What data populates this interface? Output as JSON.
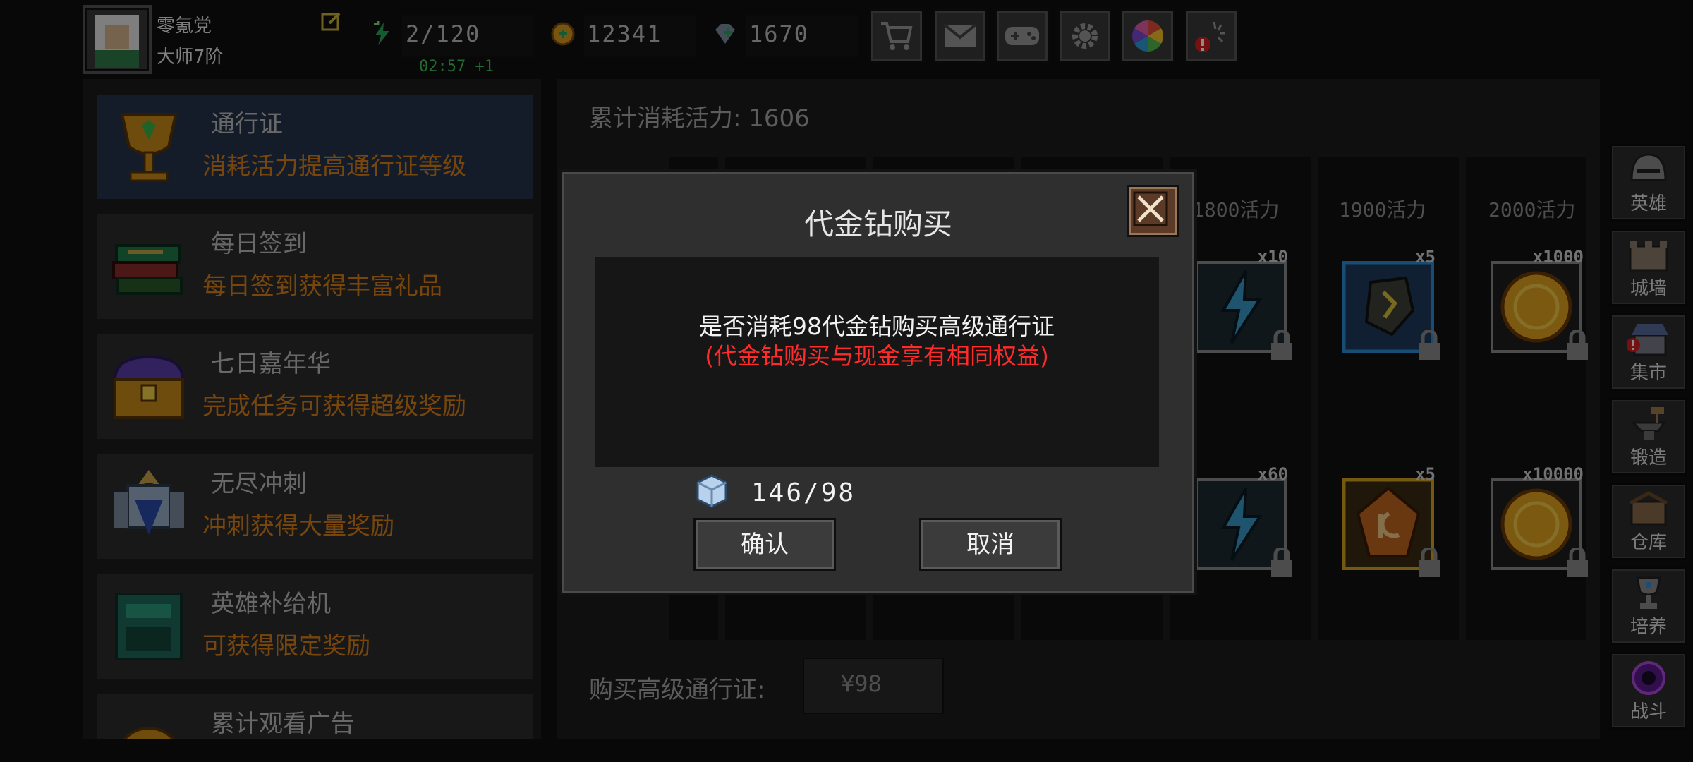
{
  "player": {
    "name": "零氪党",
    "rank": "大师7阶"
  },
  "stats": {
    "energy": "2/120",
    "energy_timer": "02:57 +1",
    "gold": "12341",
    "gems": "1670"
  },
  "top_icons": [
    "shop-cart-icon",
    "mail-icon",
    "gamepad-icon",
    "settings-gear-icon",
    "color-wheel-icon",
    "fireworks-alert-icon"
  ],
  "menu": [
    {
      "title": "通行证",
      "desc": "消耗活力提高通行证等级"
    },
    {
      "title": "每日签到",
      "desc": "每日签到获得丰富礼品"
    },
    {
      "title": "七日嘉年华",
      "desc": "完成任务可获得超级奖励"
    },
    {
      "title": "无尽冲刺",
      "desc": "冲刺获得大量奖励"
    },
    {
      "title": "英雄补给机",
      "desc": "可获得限定奖励"
    },
    {
      "title": "累计观看广告",
      "desc": ""
    }
  ],
  "pass": {
    "energy_total_label": "累计消耗活力: 1606",
    "columns": [
      {
        "label": "1800活力",
        "top_qty": "x10",
        "bottom_qty": "x60"
      },
      {
        "label": "1900活力",
        "top_qty": "x5",
        "bottom_qty": "x5"
      },
      {
        "label": "2000活力",
        "top_qty": "x1000",
        "bottom_qty": "x10000"
      }
    ],
    "buy_label": "购买高级通行证:",
    "buy_price": "¥98"
  },
  "side_nav": [
    "英雄",
    "城墙",
    "集市",
    "锻造",
    "仓库",
    "培养",
    "战斗"
  ],
  "dialog": {
    "title": "代金钻购买",
    "message": "是否消耗98代金钻购买高级通行证",
    "note": "(代金钻购买与现金享有相同权益)",
    "diamond_count": "146/98",
    "confirm": "确认",
    "cancel": "取消"
  },
  "colors": {
    "accent_orange": "#d7801b",
    "warning_red": "#ff2a2a",
    "timer_green": "#3fc35a",
    "selected_blue": "#23344a"
  }
}
